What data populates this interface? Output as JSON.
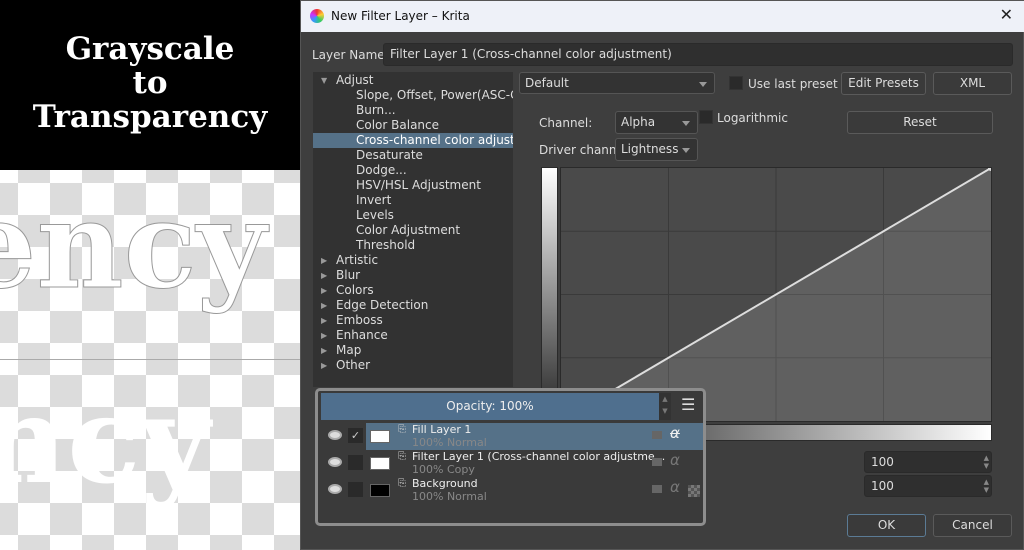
{
  "canvas": {
    "title_lines": [
      "Grayscale",
      "to",
      "Transparency"
    ],
    "text_top": "ency",
    "text_bottom": "ncy"
  },
  "window": {
    "title": "New Filter Layer – Krita",
    "close_icon": "close-icon"
  },
  "layer_name": {
    "label": "Layer Name:",
    "value": "Filter Layer 1 (Cross-channel color adjustment)"
  },
  "tree": [
    {
      "label": "Adjust",
      "level": 0,
      "expanded": true
    },
    {
      "label": "Slope, Offset, Power(ASC-CDL)",
      "level": 1
    },
    {
      "label": "Burn...",
      "level": 1
    },
    {
      "label": "Color Balance",
      "level": 1
    },
    {
      "label": "Cross-channel color adjustment",
      "level": 1,
      "selected": true
    },
    {
      "label": "Desaturate",
      "level": 1
    },
    {
      "label": "Dodge...",
      "level": 1
    },
    {
      "label": "HSV/HSL Adjustment",
      "level": 1
    },
    {
      "label": "Invert",
      "level": 1
    },
    {
      "label": "Levels",
      "level": 1
    },
    {
      "label": "Color Adjustment",
      "level": 1
    },
    {
      "label": "Threshold",
      "level": 1
    },
    {
      "label": "Artistic",
      "level": 0
    },
    {
      "label": "Blur",
      "level": 0
    },
    {
      "label": "Colors",
      "level": 0
    },
    {
      "label": "Edge Detection",
      "level": 0
    },
    {
      "label": "Emboss",
      "level": 0
    },
    {
      "label": "Enhance",
      "level": 0
    },
    {
      "label": "Map",
      "level": 0
    },
    {
      "label": "Other",
      "level": 0
    }
  ],
  "presets": {
    "value": "Default",
    "use_last_preset": "Use last preset",
    "use_last_checked": false,
    "edit_presets": "Edit Presets",
    "xml": "XML"
  },
  "channel": {
    "label": "Channel:",
    "value": "Alpha",
    "logarithmic": "Logarithmic",
    "logarithmic_checked": false,
    "reset": "Reset"
  },
  "driver": {
    "label": "Driver channel",
    "value": "Lightness"
  },
  "curve": {
    "points": [
      [
        0,
        0
      ],
      [
        1,
        1
      ]
    ]
  },
  "spin1": "100",
  "spin2": "100",
  "buttons": {
    "ok": "OK",
    "cancel": "Cancel"
  },
  "layers": {
    "opacity": "Opacity:  100%",
    "items": [
      {
        "name": "Fill Layer 1",
        "sub": "100% Normal",
        "selected": true,
        "checked": true
      },
      {
        "name": "Filter Layer 1 (Cross-channel color adjustme...",
        "sub": "100% Copy",
        "selected": false,
        "checked": false
      },
      {
        "name": "Background",
        "sub": "100% Normal",
        "selected": false,
        "checked": false
      }
    ]
  },
  "colors": {
    "selection": "#557188",
    "dialog_bg": "#3e3e3e"
  }
}
